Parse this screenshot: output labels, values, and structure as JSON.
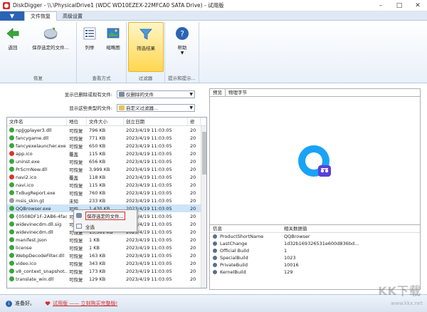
{
  "window": {
    "title": "DiskDigger - \\\\.\\PhysicalDrive1 (WDC WD10EZEX-22MFCA0 SATA Drive) - 试用版"
  },
  "ribbon": {
    "tabs": [
      "文件恢复",
      "高级设置"
    ],
    "buttons": {
      "back": "返回",
      "save_selected": "保存选定的文件...",
      "list": "列举",
      "thumbnails": "缩略图",
      "filter_results": "筛选结果",
      "help": "帮助"
    },
    "groups": {
      "recover": "恢复",
      "view": "查看方式",
      "filter": "过滤器",
      "tips": "提示和提示..."
    }
  },
  "filters": {
    "deleted_label": "显示已删除或现有文件:",
    "deleted_value": "仅删除的文件",
    "type_label": "显示这些类型的文件:",
    "type_value": "自定义过滤器..."
  },
  "file_list": {
    "columns": [
      "文件名",
      "地位",
      "文件大小",
      "创立日期",
      "修"
    ],
    "rows": [
      {
        "name": "npJjgplayer3.dll",
        "status": "可恢复",
        "size": "796 KB",
        "date": "2023/4/19 11:03:05",
        "extra": "20",
        "color": "#3aa63a"
      },
      {
        "name": "fancygame.dll",
        "status": "可恢复",
        "size": "771 KB",
        "date": "2023/4/19 11:03:05",
        "extra": "20",
        "color": "#3aa63a"
      },
      {
        "name": "fancyexelauncher.exe",
        "status": "可恢复",
        "size": "650 KB",
        "date": "2023/4/19 11:03:05",
        "extra": "20",
        "color": "#3aa63a"
      },
      {
        "name": "app.ico",
        "status": "覆盖",
        "size": "115 KB",
        "date": "2023/4/19 11:03:05",
        "extra": "20",
        "color": "#d9362b"
      },
      {
        "name": "uninst.exe",
        "status": "可恢复",
        "size": "656 KB",
        "date": "2023/4/19 11:03:05",
        "extra": "20",
        "color": "#3aa63a"
      },
      {
        "name": "PrScrnNew.dll",
        "status": "可恢复",
        "size": "3,999 KB",
        "date": "2023/4/19 11:03:05",
        "extra": "20",
        "color": "#3aa63a"
      },
      {
        "name": "navi2.ico",
        "status": "覆盖",
        "size": "118 KB",
        "date": "2023/4/19 11:03:05",
        "extra": "20",
        "color": "#d9362b"
      },
      {
        "name": "navi.ico",
        "status": "可恢复",
        "size": "115 KB",
        "date": "2023/4/19 11:03:05",
        "extra": "20",
        "color": "#3aa63a"
      },
      {
        "name": "TxBugReport.exe",
        "status": "可恢复",
        "size": "760 KB",
        "date": "2023/4/19 11:03:05",
        "extra": "20",
        "color": "#3aa63a"
      },
      {
        "name": "msis_skin.gt",
        "status": "未知",
        "size": "233 KB",
        "date": "2023/4/19 11:03:05",
        "extra": "20",
        "color": "#9a9a9a"
      },
      {
        "name": "QQBrowser.exe",
        "status": "可恢",
        "size": "1,430 KB",
        "date": "2023/4/19 11:03:05",
        "extra": "20",
        "color": "#3aa63a"
      },
      {
        "name": "{0508DF1F-2AB6-4fac...",
        "status": "可恢",
        "size": "",
        "date": "2023/4/19 11:03:05",
        "extra": "20",
        "color": "#3aa63a"
      },
      {
        "name": "widevinecdm.dll.sig",
        "status": "可恢",
        "size": "",
        "date": "2023/4/19 11:03:05",
        "extra": "20",
        "color": "#3aa63a"
      },
      {
        "name": "widevinecdm.dll",
        "status": "可恢复",
        "size": "15,561 KB",
        "date": "2023/4/19 11:03:05",
        "extra": "20",
        "color": "#3aa63a"
      },
      {
        "name": "manifest.json",
        "status": "可恢复",
        "size": "1 KB",
        "date": "2023/4/19 11:03:05",
        "extra": "20",
        "color": "#3aa63a"
      },
      {
        "name": "license",
        "status": "可恢复",
        "size": "1 KB",
        "date": "2023/4/19 11:03:05",
        "extra": "20",
        "color": "#3aa63a"
      },
      {
        "name": "WebpDecodeFilter.dll",
        "status": "可恢复",
        "size": "163 KB",
        "date": "2023/4/19 11:03:05",
        "extra": "20",
        "color": "#3aa63a"
      },
      {
        "name": "video.ico",
        "status": "可恢复",
        "size": "343 KB",
        "date": "2023/4/19 11:03:05",
        "extra": "20",
        "color": "#3aa63a"
      },
      {
        "name": "v8_context_snapshot...",
        "status": "可恢复",
        "size": "173 KB",
        "date": "2023/4/19 11:03:05",
        "extra": "20",
        "color": "#3aa63a"
      },
      {
        "name": "translate_win.dll",
        "status": "可恢复",
        "size": "129 KB",
        "date": "2023/4/19 11:03:05",
        "extra": "20",
        "color": "#3aa63a"
      }
    ],
    "selected_index": 10
  },
  "context_menu": {
    "items": [
      "保存选定的文件...",
      "全选"
    ]
  },
  "right_panel": {
    "tabs": [
      "预览",
      "物理字节"
    ],
    "props_columns": [
      "信息",
      "相关数据值"
    ],
    "props": [
      {
        "key": "ProductShortName",
        "value": "QQBrowser"
      },
      {
        "key": "LastChange",
        "value": "1d32b169326531e600d836bd..."
      },
      {
        "key": "Official Build",
        "value": "1"
      },
      {
        "key": "SpecialBuild",
        "value": "1023"
      },
      {
        "key": "PrivateBuild",
        "value": "10016"
      },
      {
        "key": "KernelBuild",
        "value": "129"
      }
    ]
  },
  "status": {
    "ready": "准备好。",
    "trial": "试用版 —— 立刻购买完整版!"
  },
  "watermark": {
    "brand": "KK下载",
    "url": "www.kkx.net"
  }
}
